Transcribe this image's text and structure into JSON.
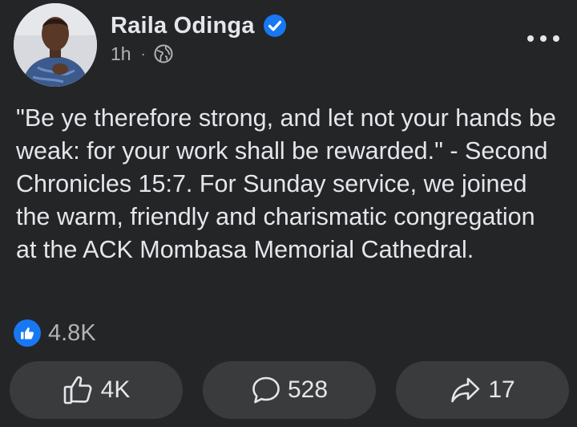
{
  "post": {
    "author": "Raila Odinga",
    "time": "1h",
    "separator": "·",
    "audience_icon": "globe-icon",
    "verified_icon": "verified-badge-icon",
    "more_icon": "more-options-icon",
    "text": "\"Be ye therefore strong, and let not your hands be weak: for your work shall be rewarded.\" - Second Chronicles 15:7. For Sunday service, we joined the warm, friendly and charismatic congregation at the ACK Mombasa Memorial Cathedral."
  },
  "reactions": {
    "icon": "like-reaction-icon",
    "count": "4.8K"
  },
  "actions": {
    "like": {
      "icon": "thumbs-up-icon",
      "count": "4K"
    },
    "comment": {
      "icon": "comment-icon",
      "count": "528"
    },
    "share": {
      "icon": "share-icon",
      "count": "17"
    }
  },
  "colors": {
    "background": "#242526",
    "text": "#e4e6eb",
    "secondary_text": "#b0b3b8",
    "button_bg": "#3a3b3c",
    "accent": "#1877f2"
  }
}
